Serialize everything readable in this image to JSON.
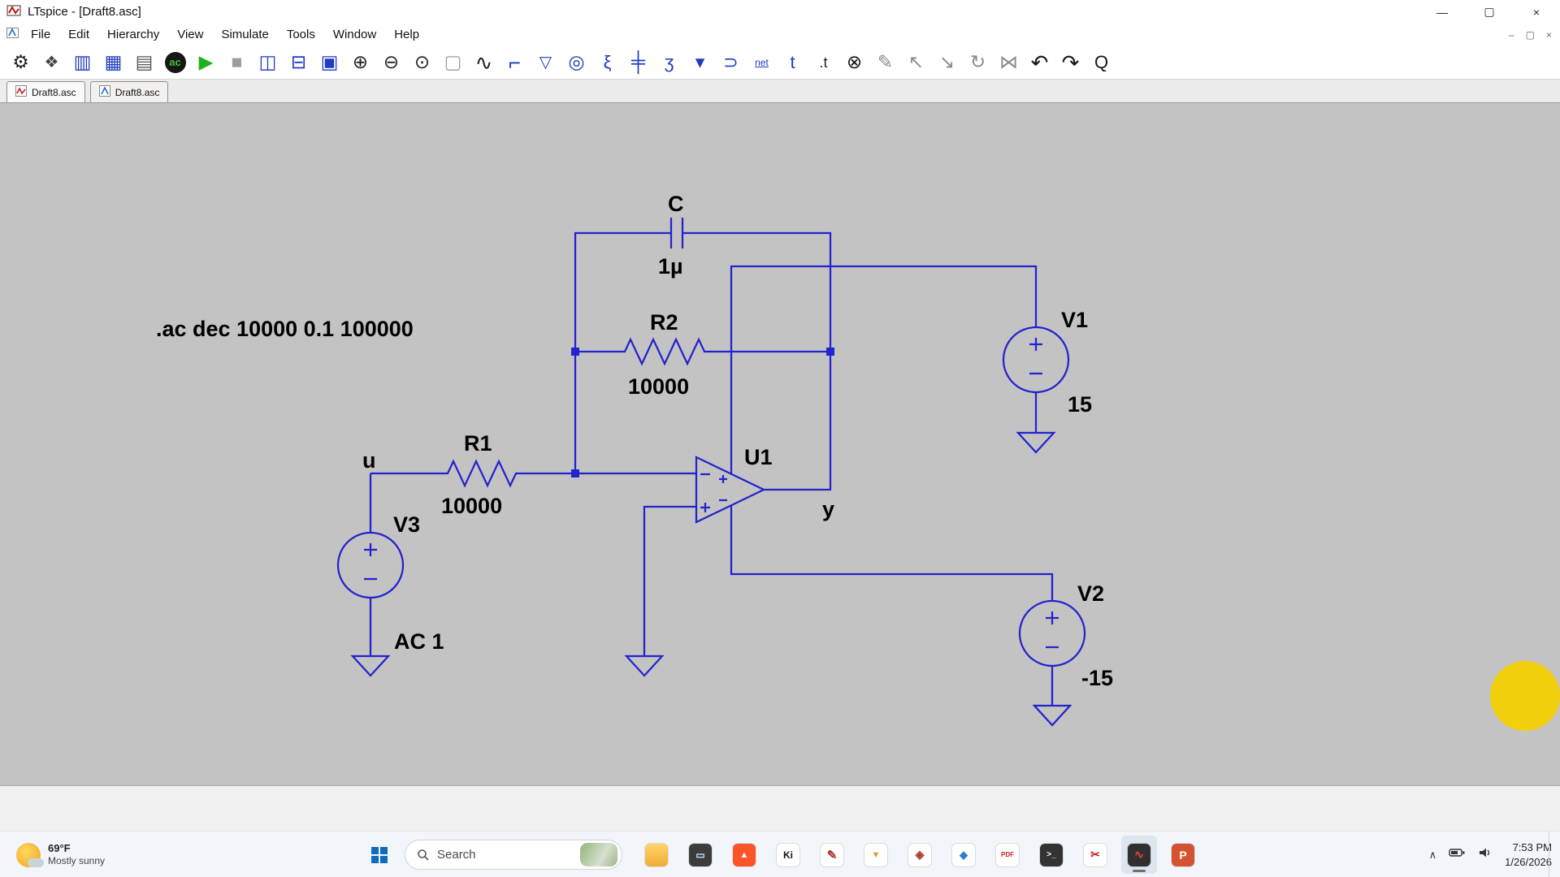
{
  "window": {
    "title": "LTspice - [Draft8.asc]",
    "controls": {
      "minimize": "—",
      "maximize": "▢",
      "close": "×"
    },
    "mdi": {
      "minimize": "–",
      "restore": "▢",
      "close": "×"
    }
  },
  "menubar": {
    "items": [
      "File",
      "Edit",
      "Hierarchy",
      "View",
      "Simulate",
      "Tools",
      "Window",
      "Help"
    ]
  },
  "toolbar": {
    "icons": [
      {
        "name": "control-panel-icon",
        "glyph": "⚙",
        "color": "#222"
      },
      {
        "name": "new-schematic-icon",
        "glyph": "❖",
        "color": "#444",
        "fs": 20
      },
      {
        "name": "open-icon",
        "glyph": "▥",
        "color": "#1f3bbf"
      },
      {
        "name": "save-icon",
        "glyph": "▦",
        "color": "#1f3bbf"
      },
      {
        "name": "print-icon",
        "glyph": "▤",
        "color": "#555"
      },
      {
        "name": "ac-analysis-icon",
        "glyph": "ac",
        "color": "#35c435",
        "bg": "#161616",
        "round": true,
        "fs": 13
      },
      {
        "name": "run-icon",
        "glyph": "▶",
        "color": "#1db31d"
      },
      {
        "name": "halt-icon",
        "glyph": "■",
        "color": "#9d9d9d"
      },
      {
        "name": "tile-vertical-icon",
        "glyph": "◫",
        "color": "#1f3bbf"
      },
      {
        "name": "tile-horizontal-icon",
        "glyph": "⊟",
        "color": "#1f3bbf"
      },
      {
        "name": "cascade-windows-icon",
        "glyph": "▣",
        "color": "#1f3bbf"
      },
      {
        "name": "zoom-in-icon",
        "glyph": "⊕",
        "color": "#222"
      },
      {
        "name": "zoom-out-icon",
        "glyph": "⊖",
        "color": "#222"
      },
      {
        "name": "zoom-full-extents-icon",
        "glyph": "⊙",
        "color": "#222"
      },
      {
        "name": "pan-icon",
        "glyph": "▢",
        "color": "#9d9d9d"
      },
      {
        "name": "waveform-viewer-icon",
        "glyph": "∿",
        "color": "#222",
        "fs": 26
      },
      {
        "name": "wire-icon",
        "glyph": "⌐",
        "color": "#1f3bbf",
        "fs": 26
      },
      {
        "name": "ground-icon",
        "glyph": "▽",
        "color": "#1f3bbf",
        "fs": 20
      },
      {
        "name": "voltage-source-icon",
        "glyph": "◎",
        "color": "#1f3bbf"
      },
      {
        "name": "resistor-icon",
        "glyph": "ξ",
        "color": "#1f3bbf",
        "fs": 22
      },
      {
        "name": "capacitor-icon",
        "glyph": "╪",
        "color": "#1f3bbf",
        "fs": 24
      },
      {
        "name": "inductor-icon",
        "glyph": "ʒ",
        "color": "#1f3bbf",
        "fs": 22
      },
      {
        "name": "diode-icon",
        "glyph": "▾",
        "color": "#1f3bbf"
      },
      {
        "name": "component-icon",
        "glyph": "⊃",
        "color": "#1f3bbf",
        "fs": 22
      },
      {
        "name": "net-label-icon",
        "glyph": "net",
        "color": "#1f3bbf",
        "fs": 12,
        "u": true
      },
      {
        "name": "text-tool-icon",
        "glyph": "t",
        "color": "#1f3bbf",
        "fs": 22
      },
      {
        "name": "spice-directive-icon",
        "glyph": ".t",
        "color": "#222",
        "fs": 18
      },
      {
        "name": "delete-icon",
        "glyph": "⊗",
        "color": "#161616"
      },
      {
        "name": "find-icon",
        "glyph": "✎",
        "color": "#8a8a8a"
      },
      {
        "name": "move-icon",
        "glyph": "↖",
        "color": "#8a8a8a"
      },
      {
        "name": "drag-icon",
        "glyph": "↘",
        "color": "#8a8a8a"
      },
      {
        "name": "paste-icon",
        "glyph": "↻",
        "color": "#8a8a8a"
      },
      {
        "name": "mirror-icon",
        "glyph": "⋈",
        "color": "#8a8a8a"
      },
      {
        "name": "undo-icon",
        "glyph": "↶",
        "color": "#161616",
        "fs": 26
      },
      {
        "name": "redo-icon",
        "glyph": "↷",
        "color": "#161616",
        "fs": 26
      },
      {
        "name": "search-icon",
        "glyph": "Q",
        "color": "#161616",
        "fs": 22
      }
    ]
  },
  "tabs": [
    {
      "label": "Draft8.asc"
    },
    {
      "label": "Draft8.asc"
    }
  ],
  "schematic": {
    "directive": ".ac dec 10000 0.1 100000",
    "cap": {
      "name": "C",
      "value": "1µ"
    },
    "r1": {
      "name": "R1",
      "value": "10000"
    },
    "r2": {
      "name": "R2",
      "value": "10000"
    },
    "u1": {
      "name": "U1"
    },
    "v1": {
      "name": "V1",
      "value": "15"
    },
    "v2": {
      "name": "V2",
      "value": "-15"
    },
    "v3": {
      "name": "V3",
      "value": "AC 1"
    },
    "net_in": "u",
    "net_out": "y"
  },
  "colors": {
    "wire": "#2323ce",
    "highlight": "#f2cf0c",
    "canvas": "#c3c3c3"
  },
  "taskbar": {
    "weather": {
      "temp": "69°F",
      "condition": "Mostly sunny"
    },
    "search_label": "Search",
    "apps": [
      {
        "name": "file-explorer",
        "glyph": "",
        "bg": "linear-gradient(180deg,#ffd46b,#f1ab33)",
        "fg": "#fff"
      },
      {
        "name": "virtual-machine",
        "glyph": "▭",
        "bg": "#3c3c3c",
        "fg": "#cfe3ff",
        "fs": 12
      },
      {
        "name": "brave-browser",
        "glyph": "▲",
        "bg": "#fb542b",
        "fg": "#fff",
        "fs": 11
      },
      {
        "name": "kicad",
        "glyph": "Ki",
        "bg": "#ffffff",
        "fg": "#111111",
        "fs": 12
      },
      {
        "name": "pencil-tool",
        "glyph": "✎",
        "bg": "#ffffff",
        "fg": "#b5342c",
        "fs": 15
      },
      {
        "name": "honey-jar-app",
        "glyph": "▼",
        "bg": "#ffffff",
        "fg": "#e09b2d",
        "fs": 11
      },
      {
        "name": "kicad-footprint",
        "glyph": "◈",
        "bg": "#ffffff",
        "fg": "#b03a2e",
        "fs": 14
      },
      {
        "name": "photos",
        "glyph": "◆",
        "bg": "#ffffff",
        "fg": "#2d7cd6",
        "fs": 13
      },
      {
        "name": "pdf-viewer",
        "glyph": "PDF",
        "bg": "#ffffff",
        "fg": "#c62222",
        "fs": 8
      },
      {
        "name": "windows-terminal",
        "glyph": ">_",
        "bg": "#333333",
        "fg": "#ffffff",
        "fs": 10
      },
      {
        "name": "red-utility",
        "glyph": "✂",
        "bg": "#ffffff",
        "fg": "#c62222",
        "fs": 14
      },
      {
        "name": "ltspice",
        "glyph": "∿",
        "bg": "#303030",
        "fg": "#e8452f",
        "fs": 14,
        "active": true
      },
      {
        "name": "powerpoint",
        "glyph": "P",
        "bg": "#d35230",
        "fg": "#ffffff",
        "fs": 14
      }
    ],
    "tray": {
      "chevron": "∧"
    },
    "clock": {
      "time": "7:53 PM",
      "date": "1/26/2026"
    }
  }
}
